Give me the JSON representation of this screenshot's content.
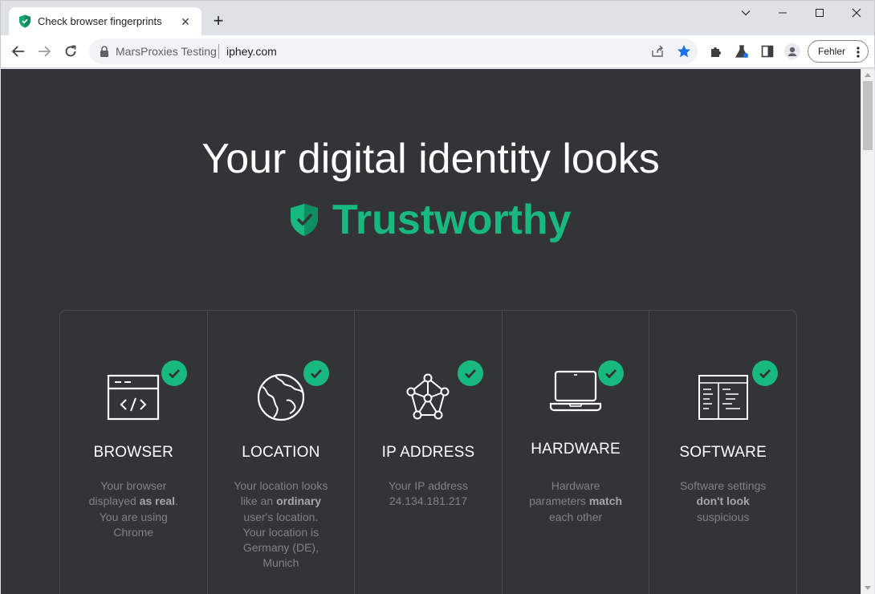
{
  "browser": {
    "tab_title": "Check browser fingerprints",
    "tab_close": "✕",
    "new_tab": "+",
    "site_label": "MarsProxies Testing",
    "url": "iphey.com",
    "profile_label": "Fehler",
    "accent_color": "#1a73e8"
  },
  "page": {
    "headline": "Your digital identity looks",
    "verdict": "Trustworthy",
    "verdict_color": "#17b97e",
    "cards": [
      {
        "title": "BROWSER",
        "icon": "browser-code-icon",
        "desc": [
          {
            "t": "Your browser displayed "
          },
          {
            "t": "as real",
            "b": true
          },
          {
            "t": ". You are using Chrome"
          }
        ]
      },
      {
        "title": "LOCATION",
        "icon": "globe-icon",
        "desc": [
          {
            "t": "Your location looks like an "
          },
          {
            "t": "ordinary",
            "b": true
          },
          {
            "t": " user's location. Your location is Germany (DE), Munich"
          }
        ]
      },
      {
        "title": "IP ADDRESS",
        "icon": "network-nodes-icon",
        "desc": [
          {
            "t": "Your IP address 24.134.181.217"
          }
        ]
      },
      {
        "title": "HARDWARE",
        "icon": "laptop-icon",
        "desc": [
          {
            "t": "Hardware parameters "
          },
          {
            "t": "match",
            "b": true
          },
          {
            "t": " each other"
          }
        ]
      },
      {
        "title": "SOFTWARE",
        "icon": "software-window-icon",
        "desc": [
          {
            "t": "Software settings "
          },
          {
            "t": "don't look",
            "b": true
          },
          {
            "t": " suspicious"
          }
        ]
      }
    ]
  }
}
